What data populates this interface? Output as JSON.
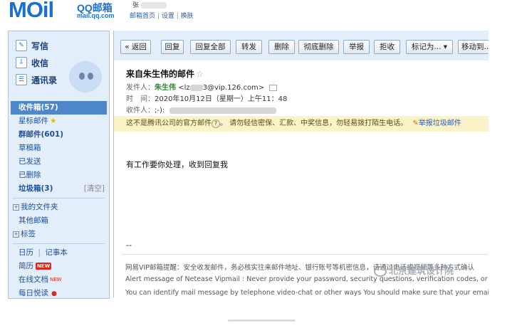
{
  "header": {
    "logo_mail": "MOil",
    "logo_qq": "QQ邮箱",
    "logo_domain": "mail.qq.com",
    "user": "张",
    "links": [
      "邮箱首页",
      "设置",
      "换肤"
    ],
    "link_sep": "|"
  },
  "sidebar": {
    "compose": [
      {
        "label": "写信",
        "icon": "pencil-icon"
      },
      {
        "label": "收信",
        "icon": "inbox-download-icon"
      },
      {
        "label": "通讯录",
        "icon": "contacts-icon"
      }
    ],
    "folders": [
      {
        "label": "收件箱(57)",
        "active": true,
        "bold": true
      },
      {
        "label": "星标邮件",
        "star": "★"
      },
      {
        "label": "群邮件(601)",
        "bold": true
      },
      {
        "label": "草稿箱"
      },
      {
        "label": "已发送"
      },
      {
        "label": "已删除"
      },
      {
        "label": "垃圾箱(3)",
        "bold": true,
        "extra": "[清空]"
      }
    ],
    "collapsibles": [
      {
        "toggle": "+",
        "label": "我的文件夹"
      },
      {
        "label": "其他邮箱",
        "indent": true
      },
      {
        "toggle": "+",
        "label": "标签"
      }
    ],
    "apps": [
      {
        "label": "日历",
        "label2": "记事本",
        "sep": "|"
      },
      {
        "label": "简历",
        "tag": "NEW"
      },
      {
        "label": "在线文档",
        "sup": "NEW"
      },
      {
        "label": "每日悦读",
        "dot": "●"
      }
    ]
  },
  "toolbar": {
    "back": "« 返回",
    "buttons": [
      "回复",
      "回复全部",
      "转发",
      "删除",
      "彻底删除",
      "举报",
      "拒收"
    ],
    "mark_as": "标记为...",
    "mark_arrow": "▾",
    "move_to": "移动到..."
  },
  "email": {
    "subject": "来自朱生伟的邮件",
    "star": "☆",
    "from_label": "发件人：",
    "from_name": "朱生伟",
    "from_addr_start": "<lz",
    "from_addr_end": "3@vip.126.com>",
    "time_label": "时　间：",
    "time_value": "2020年10月12日（星期一）上午11：48",
    "to_label": "收件人：",
    "to_value": ";-):",
    "warning": "这不是腾讯公司的官方邮件",
    "warning_q": "?",
    "warning_tail": "。 请勿轻信密保、汇款、中奖信息，勿轻易拨打陌生电话。",
    "report": "举报垃圾邮件",
    "body": "有工作要你处理，收到回复我",
    "signature": "--"
  },
  "vip_notice": {
    "line1": "网易VIP邮箱提醒：安全收发邮件，务必核实往来邮件地址、银行账号等机密信息，请通过电话或视频等多种方式确认",
    "line2": "Alert message of Netease Vipmail : Never provide your password, security questions, verification codes, or any othe",
    "line3": "You can identify mail message by telephone video-chat or other ways You should make sure that your email address"
  },
  "watermark": "北京建筑设计院",
  "colors": {
    "brand": "#1a6fd1",
    "sidebar_bg": "#e3eefb",
    "active_folder": "#4d86c9",
    "warning_bg": "#fbf3c8",
    "sender_green": "#2a8a2a"
  }
}
